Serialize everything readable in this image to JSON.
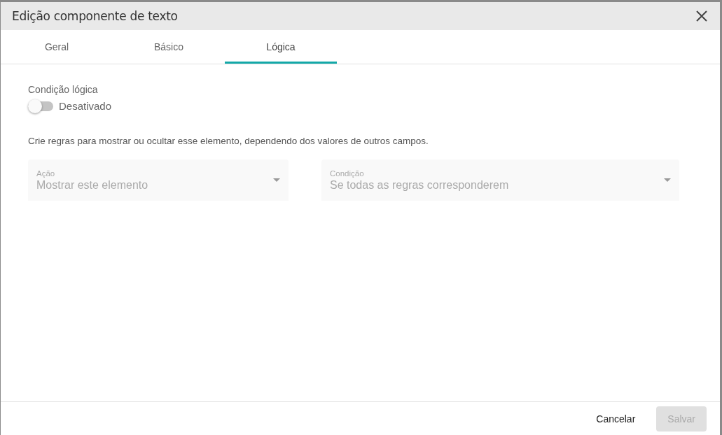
{
  "dialog": {
    "title": "Edição componente de texto"
  },
  "tabs": [
    {
      "label": "Geral",
      "selected": false
    },
    {
      "label": "Básico",
      "selected": false
    },
    {
      "label": "Lógica",
      "selected": true
    }
  ],
  "logic": {
    "label": "Condição lógica",
    "toggle": {
      "label": "Desativado",
      "on": false
    },
    "description": "Crie regras para mostrar ou ocultar esse elemento, dependendo dos valores de outros campos.",
    "fields": [
      {
        "label": "Ação",
        "value": "Mostrar este elemento",
        "disabled": true
      },
      {
        "label": "Condição",
        "value": "Se todas as regras corresponderem",
        "disabled": true
      }
    ]
  },
  "buttons": [
    {
      "label": "Cancelar",
      "disabled": false
    },
    {
      "label": "Salvar",
      "disabled": true
    }
  ]
}
